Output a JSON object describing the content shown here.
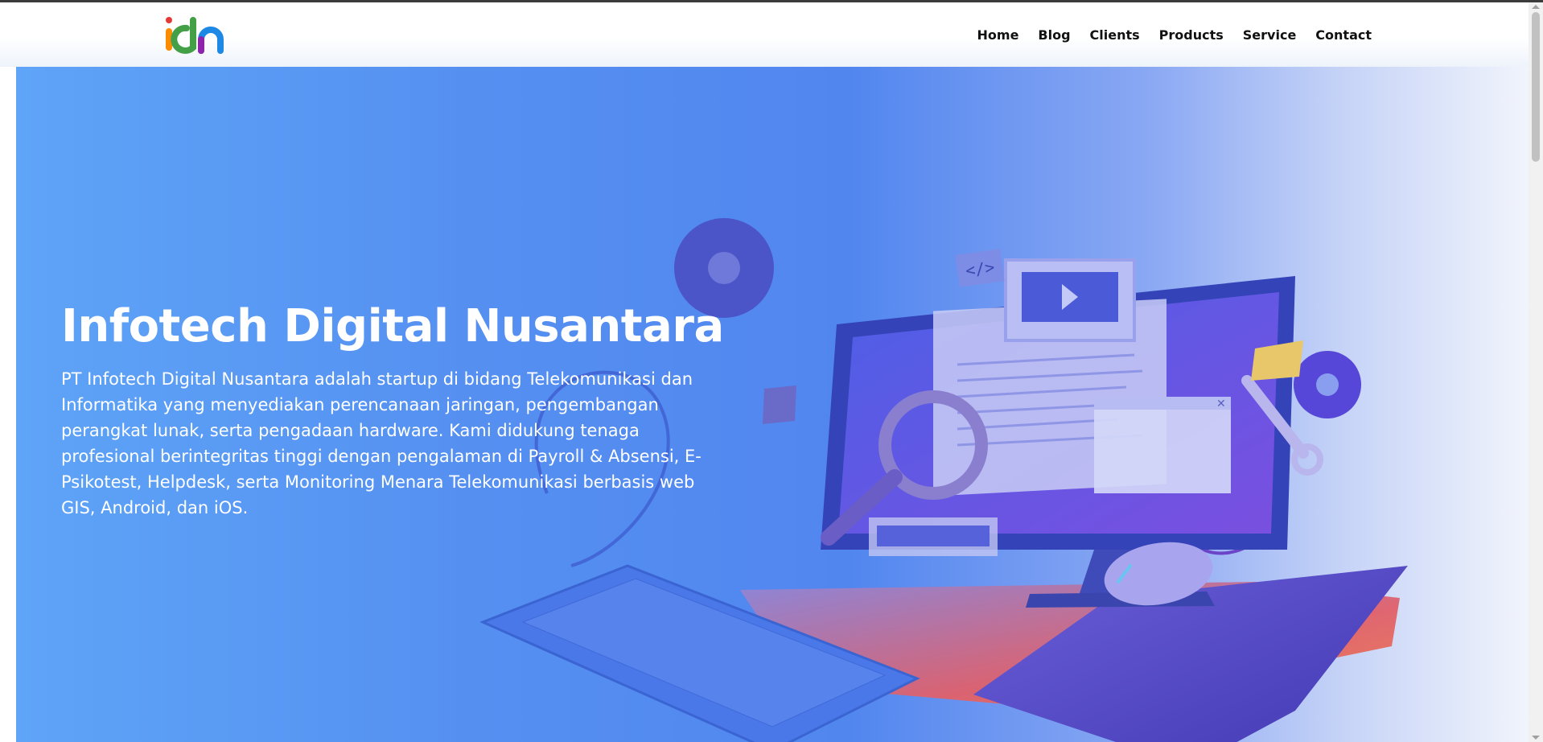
{
  "brand": {
    "logo_text": "idn",
    "colors": [
      "#e53935",
      "#fb8c00",
      "#43a047",
      "#1e88e5",
      "#8e24aa"
    ]
  },
  "nav": {
    "items": [
      {
        "label": "Home"
      },
      {
        "label": "Blog"
      },
      {
        "label": "Clients"
      },
      {
        "label": "Products"
      },
      {
        "label": "Service"
      },
      {
        "label": "Contact"
      }
    ]
  },
  "hero": {
    "title": "Infotech Digital Nusantara",
    "description": "PT Infotech Digital Nusantara adalah startup di bidang Telekomunikasi dan Informatika yang menyediakan perencanaan jaringan, pengembangan perangkat lunak, serta pengadaan hardware. Kami didukung tenaga profesional berintegritas tinggi dengan pengalaman di Payroll & Absensi, E-Psikotest, Helpdesk, serta Monitoring Menara Telekomunikasi berbasis web GIS, Android, dan iOS.",
    "illustration": "computer-workspace-illustration"
  },
  "colors": {
    "hero_start": "#5ea4f7",
    "hero_end": "#f1f4fc",
    "nav_text": "#111111"
  }
}
